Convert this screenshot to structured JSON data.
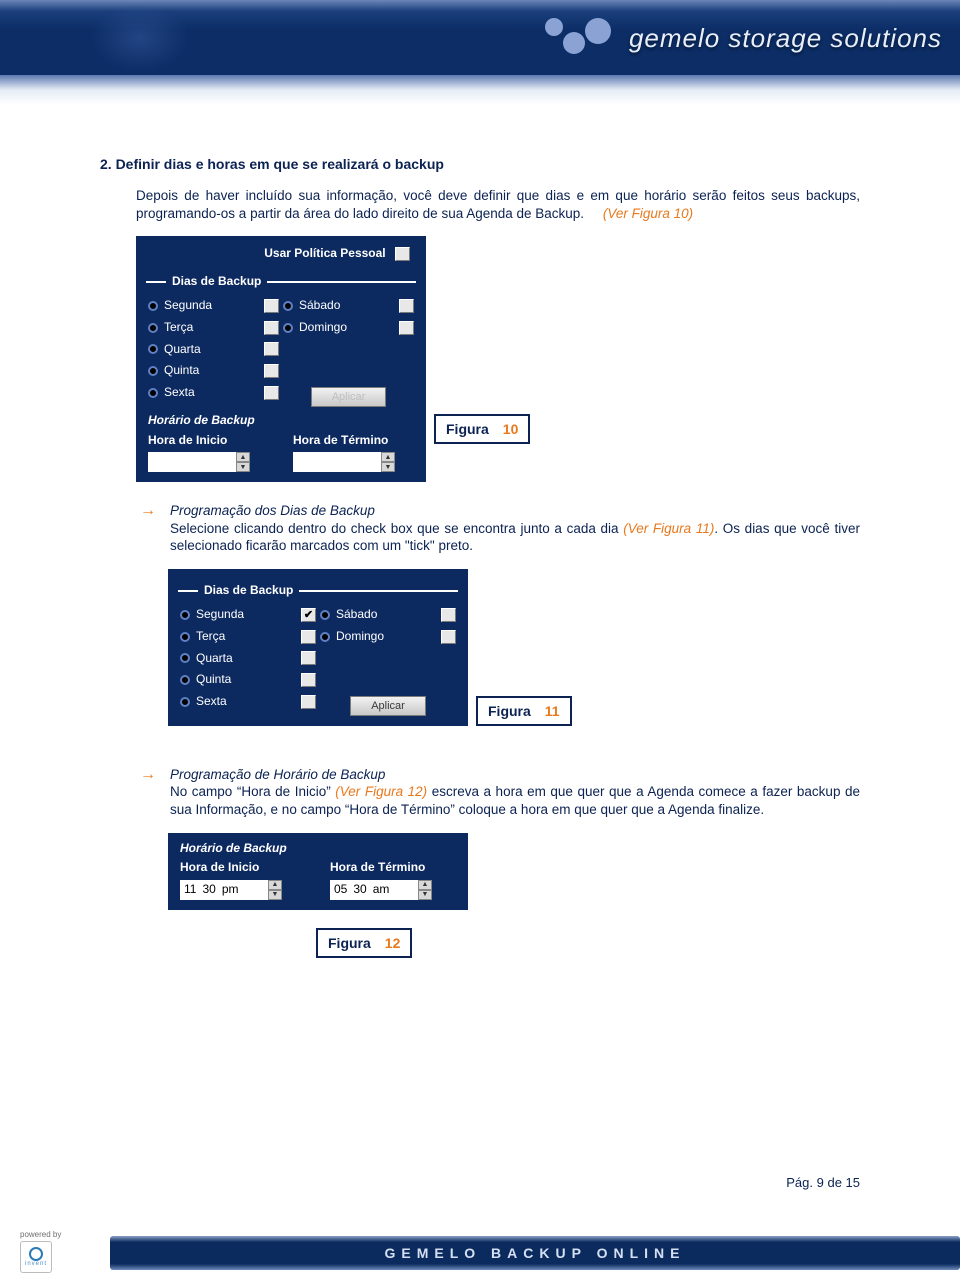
{
  "brand": {
    "name": "gemelo storage solutions"
  },
  "section": {
    "heading": "2.  Definir dias e horas em que se realizará o backup",
    "intro": "Depois de haver incluído sua informação, você deve definir que dias e em que horário serão feitos seus backups, programando-os a partir da área do lado direito de sua Agenda de Backup.",
    "intro_ref": "(Ver Figura 10)"
  },
  "panel1": {
    "usar_politica": "Usar Política Pessoal",
    "dias_header": "Dias de Backup",
    "days_left": [
      "Segunda",
      "Terça",
      "Quarta",
      "Quinta",
      "Sexta"
    ],
    "days_right": [
      "Sábado",
      "Domingo"
    ],
    "btn": "Aplicar",
    "horario_header": "Horário de Backup",
    "hora_inicio": "Hora de Inicio",
    "hora_termino": "Hora de Término"
  },
  "figure10": {
    "label": "Figura",
    "num": "10"
  },
  "step1": {
    "title": "Programação dos Dias de Backup",
    "line1a": "Selecione clicando dentro do check box que se encontra junto a cada dia ",
    "line1ref": "(Ver Figura 11)",
    "line1b": ". Os dias que você tiver selecionado ficarão marcados com um \"tick\" preto."
  },
  "panel2": {
    "dias_header": "Dias de Backup",
    "days_left": [
      "Segunda",
      "Terça",
      "Quarta",
      "Quinta",
      "Sexta"
    ],
    "days_right": [
      "Sábado",
      "Domingo"
    ],
    "checked_day": "Segunda",
    "btn": "Aplicar"
  },
  "figure11": {
    "label": "Figura",
    "num": "11"
  },
  "step2": {
    "title": "Programação de Horário de Backup",
    "body_a": "No campo “Hora de Inicio” ",
    "body_ref": "(Ver Figura 12)",
    "body_b": " escreva a hora em que quer que a Agenda comece a fazer backup de sua Informação, e no campo “Hora de Término” coloque a hora em que quer que a Agenda finalize."
  },
  "panel3": {
    "horario_header": "Horário de Backup",
    "hora_inicio": "Hora de Inicio",
    "hora_termino": "Hora de Término",
    "val_inicio": {
      "hh": "11",
      "mm": "30",
      "ap": "pm"
    },
    "val_termino": {
      "hh": "05",
      "mm": "30",
      "ap": "am"
    }
  },
  "figure12": {
    "label": "Figura",
    "num": "12"
  },
  "footer": {
    "powered": "powered by",
    "hp": "invent",
    "strip": "GEMELO   BACKUP   ONLINE",
    "page": "Pág. 9 de 15"
  }
}
